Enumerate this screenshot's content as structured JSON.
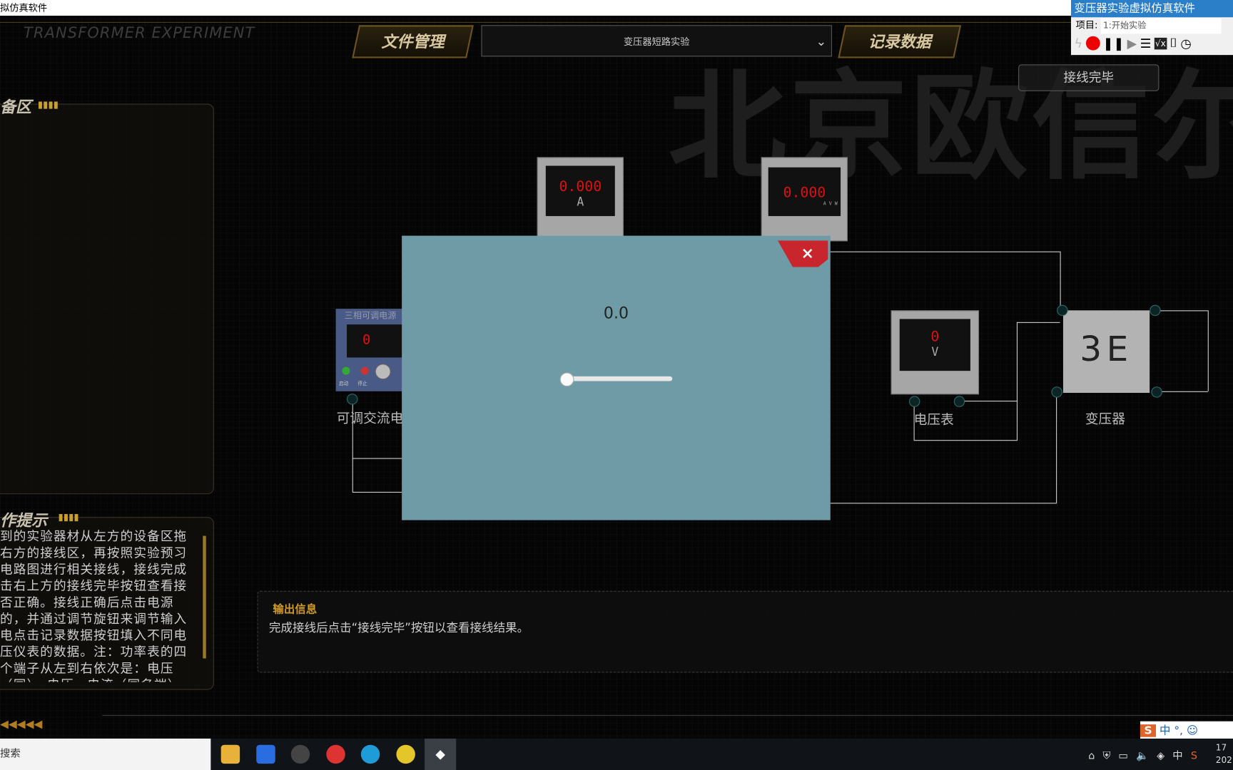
{
  "window_title": "拟仿真软件",
  "recorder": {
    "title": "变压器实验虚拟仿真软件",
    "project_label": "项目:",
    "project_value": "1:开始实验"
  },
  "header": {
    "subtitle": "TRANSFORMER EXPERIMENT",
    "file_btn": "文件管理",
    "experiment_select": "变压器短路实验",
    "record_btn": "记录数据",
    "wiring_done_btn": "接线完毕"
  },
  "watermark": "北京欧信尔",
  "device_area": {
    "title": "备区"
  },
  "hints": {
    "title": "作提示",
    "text": "到的实验器材从左方的设备区拖右方的接线区，再按照实验预习电路图进行相关接线，接线完成击右上方的接线完毕按钮查看接否正确。接线正确后点击电源的，并通过调节旋钮来调节输入电点击记录数据按钮填入不同电压仪表的数据。注：功率表的四个端子从左到右依次是：电压（同）、电压、电流（同名端）、电"
  },
  "devices": {
    "ammeter": {
      "value": "0.000",
      "unit": "A"
    },
    "power_meter": {
      "value": "0.000",
      "units": "A V W"
    },
    "source": {
      "title": "三相可调电源",
      "value": "0",
      "label": "可调交流电",
      "btn1": "启动",
      "btn2": "停止"
    },
    "voltmeter": {
      "value": "0",
      "unit": "V",
      "label": "电压表"
    },
    "transformer": {
      "label": "变压器"
    }
  },
  "modal": {
    "value": "0.0",
    "slider_fraction": 0.0,
    "close": "×"
  },
  "output": {
    "title": "输出信息",
    "text": "完成接线后点击“接线完毕”按钮以查看接线结果。"
  },
  "taskbar": {
    "search": "搜索",
    "ime": "中",
    "time": "17",
    "date": "202"
  },
  "colors": {
    "modal_bg": "#6f9ba6",
    "accent": "#d09a2a",
    "close": "#c8252c"
  }
}
